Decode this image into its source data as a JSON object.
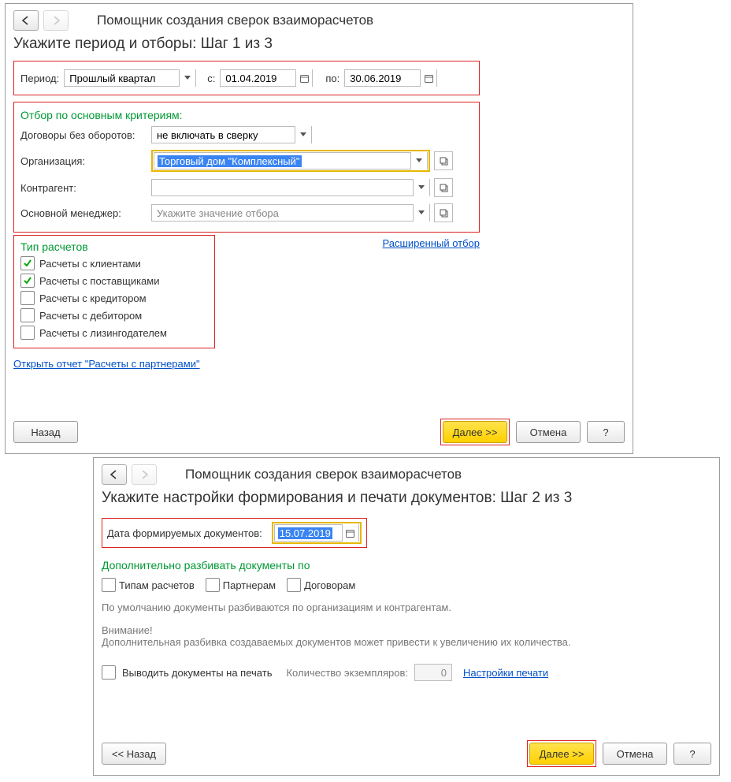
{
  "title": "Помощник создания сверок взаиморасчетов",
  "w1": {
    "heading": "Укажите период и отборы:  Шаг 1 из 3",
    "period_label": "Период:",
    "period_value": "Прошлый квартал",
    "from_label": "с:",
    "from_value": "01.04.2019",
    "to_label": "по:",
    "to_value": "30.06.2019",
    "criteria_header": "Отбор по основным критериям:",
    "contracts_label": "Договоры без оборотов:",
    "contracts_value": "не включать в сверку",
    "org_label": "Организация:",
    "org_value": "Торговый дом \"Комплексный\"",
    "counter_label": "Контрагент:",
    "counter_value": "",
    "manager_label": "Основной менеджер:",
    "manager_placeholder": "Укажите значение отбора",
    "ext_filter": "Расширенный отбор",
    "types_header": "Тип расчетов",
    "types": [
      {
        "label": "Расчеты с клиентами",
        "checked": true
      },
      {
        "label": "Расчеты с поставщиками",
        "checked": true
      },
      {
        "label": "Расчеты с кредитором",
        "checked": false
      },
      {
        "label": "Расчеты с дебитором",
        "checked": false
      },
      {
        "label": "Расчеты с лизингодателем",
        "checked": false
      }
    ],
    "open_report": "Открыть отчет \"Расчеты с партнерами\"",
    "back": "Назад",
    "next": "Далее >>",
    "cancel": "Отмена",
    "help": "?"
  },
  "w2": {
    "heading": "Укажите настройки формирования и печати документов:  Шаг 2 из 3",
    "date_label": "Дата формируемых документов:",
    "date_value": "15.07.2019",
    "split_header": "Дополнительно разбивать документы по",
    "split": [
      {
        "label": "Типам расчетов",
        "checked": false
      },
      {
        "label": "Партнерам",
        "checked": false
      },
      {
        "label": "Договорам",
        "checked": false
      }
    ],
    "split_note": "По умолчанию документы разбиваются по организациям и контрагентам.",
    "warn1": "Внимание!",
    "warn2": "Дополнительная разбивка создаваемых документов может привести к увеличению их количества.",
    "print_cb": "Выводить документы на печать",
    "copies_label": "Количество экземпляров:",
    "copies_value": "0",
    "print_settings": "Настройки печати",
    "back": "<< Назад",
    "next": "Далее >>",
    "cancel": "Отмена",
    "help": "?"
  }
}
